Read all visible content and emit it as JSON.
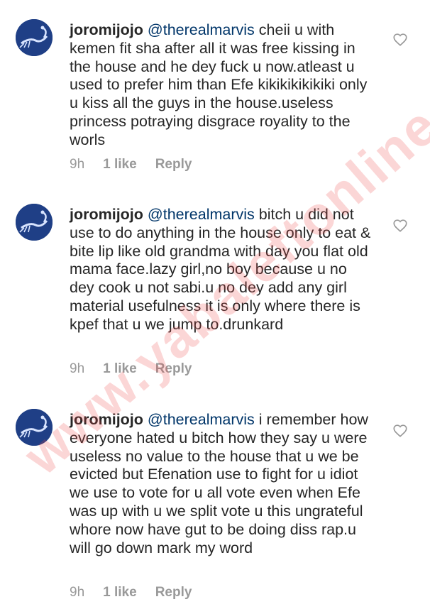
{
  "comments": [
    {
      "username": "joromijojo",
      "mention": "@therealmarvis",
      "body": "cheii u with kemen fit sha after all it was free kissing in the house and he dey fuck u now.atleast u used to prefer him than Efe kikikikikikiki only u kiss all the guys in the house.useless princess potraying disgrace royality to the worls",
      "time": "9h",
      "likes": "1 like",
      "reply": "Reply"
    },
    {
      "username": "joromijojo",
      "mention": "@therealmarvis",
      "body": "bitch u did not use to do anything in the house only to eat & bite lip like old grandma with day you flat old mama face.lazy girl,no boy because u no dey cook u not sabi.u no dey add any girl material usefulness it is only where there is kpef that u we jump to.drunkard",
      "time": "9h",
      "likes": "1 like",
      "reply": "Reply"
    },
    {
      "username": "joromijojo",
      "mention": "@therealmarvis",
      "body": "i remember how everyone hated u bitch how they say u were useless no value to the house that u we be evicted but Efenation use to fight for u idiot we use to vote for u all vote even when Efe was up with u we split vote u this ungrateful whore now have gut to be doing diss rap.u will go down mark my word",
      "time": "9h",
      "likes": "1 like",
      "reply": "Reply"
    }
  ],
  "watermark": "www.yabaleftonline.com",
  "icons": {
    "avatar": "scorpion-avatar-icon",
    "like": "heart-outline-icon"
  },
  "colors": {
    "text": "#262626",
    "mention": "#003569",
    "meta": "#999999",
    "watermark": "#eb4646"
  }
}
